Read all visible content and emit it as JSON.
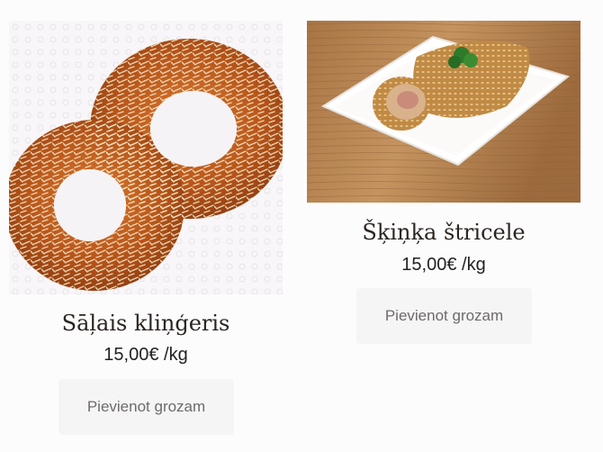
{
  "products": [
    {
      "name": "Sāļais kliņģeris",
      "price": "15,00€ /kg",
      "add_to_cart_label": "Pievienot grozam",
      "image_icon": "pretzel-photo"
    },
    {
      "name": "Šķiņķa štricele",
      "price": "15,00€ /kg",
      "add_to_cart_label": "Pievienot grozam",
      "image_icon": "ham-roll-photo"
    }
  ],
  "colors": {
    "background": "#fdfcfd",
    "button_bg": "#f6f5f6",
    "button_text": "#6e6a6c",
    "title_text": "#2a2520"
  }
}
